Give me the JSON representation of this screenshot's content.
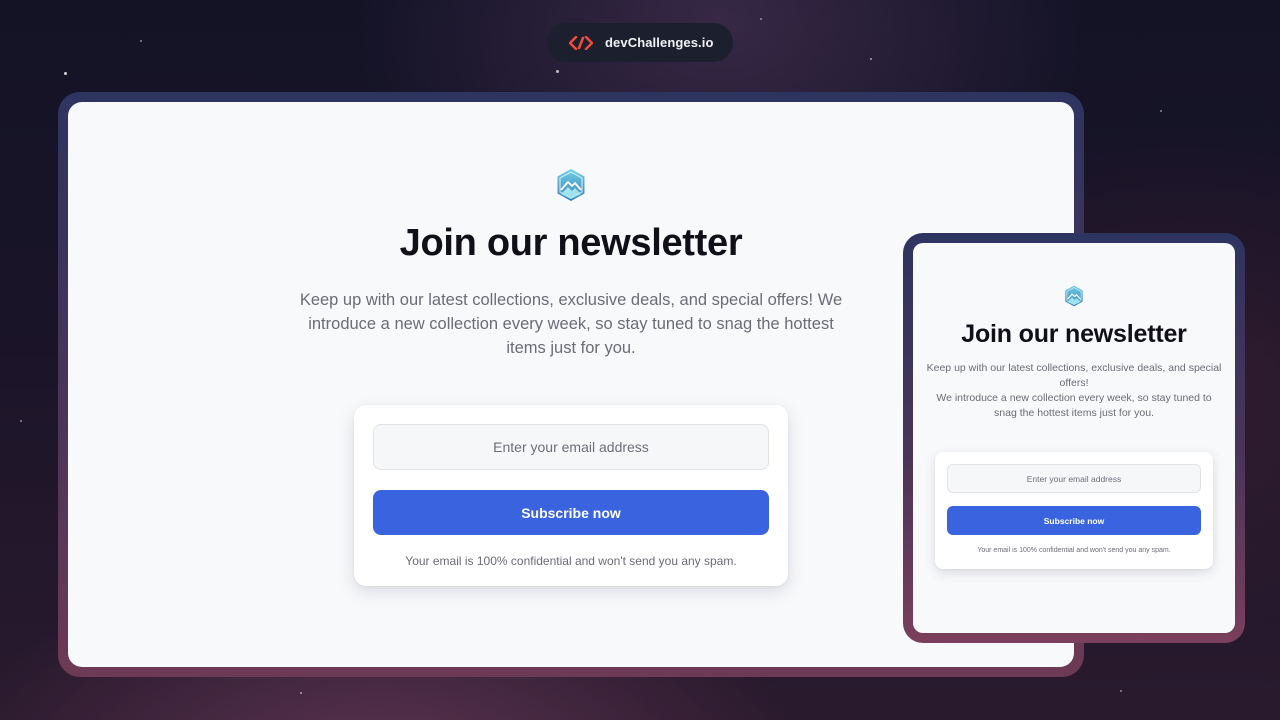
{
  "brand": {
    "name": "devChallenges.io",
    "logo_icon": "devchallenges-logo-icon",
    "accent_color": "#f04b3a"
  },
  "desktop": {
    "logo_icon": "mountain-hexagon-icon",
    "title": "Join our newsletter",
    "description": "Keep up with our latest collections, exclusive deals, and special offers! We introduce a new collection every week, so stay tuned to snag the hottest items just for you.",
    "form": {
      "email_placeholder": "Enter your email address",
      "email_value": "",
      "subscribe_label": "Subscribe now",
      "note": "Your email is 100% confidential and won't send you any spam."
    }
  },
  "mobile": {
    "logo_icon": "mountain-hexagon-icon",
    "title": "Join our newsletter",
    "description": "Keep up with our latest collections, exclusive deals, and special offers!\nWe introduce a new collection every week, so stay tuned to snag the hottest items just for you.",
    "form": {
      "email_placeholder": "Enter your email address",
      "email_value": "",
      "subscribe_label": "Subscribe now",
      "note": "Your email is 100% confidential and won't send you any spam."
    }
  },
  "colors": {
    "primary_button": "#3a63e0",
    "title_text": "#111018",
    "body_text": "#6b6c75",
    "card_background": "#ffffff",
    "screen_background": "#f8f9fb"
  }
}
